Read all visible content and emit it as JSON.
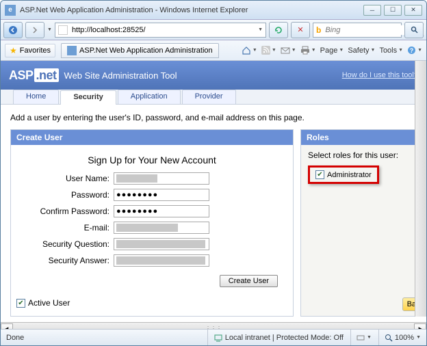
{
  "window": {
    "title": "ASP.Net Web Application Administration - Windows Internet Explorer"
  },
  "nav": {
    "url": "http://localhost:28525/",
    "search_placeholder": "Bing"
  },
  "favbar": {
    "favorites": "Favorites",
    "tab": "ASP.Net Web Application Administration"
  },
  "cmdbar": {
    "page": "Page",
    "safety": "Safety",
    "tools": "Tools"
  },
  "asp": {
    "logo_asp": "ASP",
    "logo_net": ".net",
    "tool": "Web Site Administration Tool",
    "help": "How do I use this tool?",
    "tabs": {
      "home": "Home",
      "security": "Security",
      "application": "Application",
      "provider": "Provider"
    }
  },
  "page": {
    "instruction": "Add a user by entering the user's ID, password, and e-mail address on this page.",
    "create_user_head": "Create User",
    "signup": "Sign Up for Your New Account",
    "labels": {
      "username": "User Name:",
      "password": "Password:",
      "confirm": "Confirm Password:",
      "email": "E-mail:",
      "question": "Security Question:",
      "answer": "Security Answer:"
    },
    "password_mask": "●●●●●●●●",
    "create_btn": "Create User",
    "active_user": "Active User",
    "roles_head": "Roles",
    "roles_instr": "Select roles for this user:",
    "role_admin": "Administrator",
    "back": "Bacl"
  },
  "status": {
    "done": "Done",
    "zone": "Local intranet | Protected Mode: Off",
    "zoom": "100%"
  }
}
